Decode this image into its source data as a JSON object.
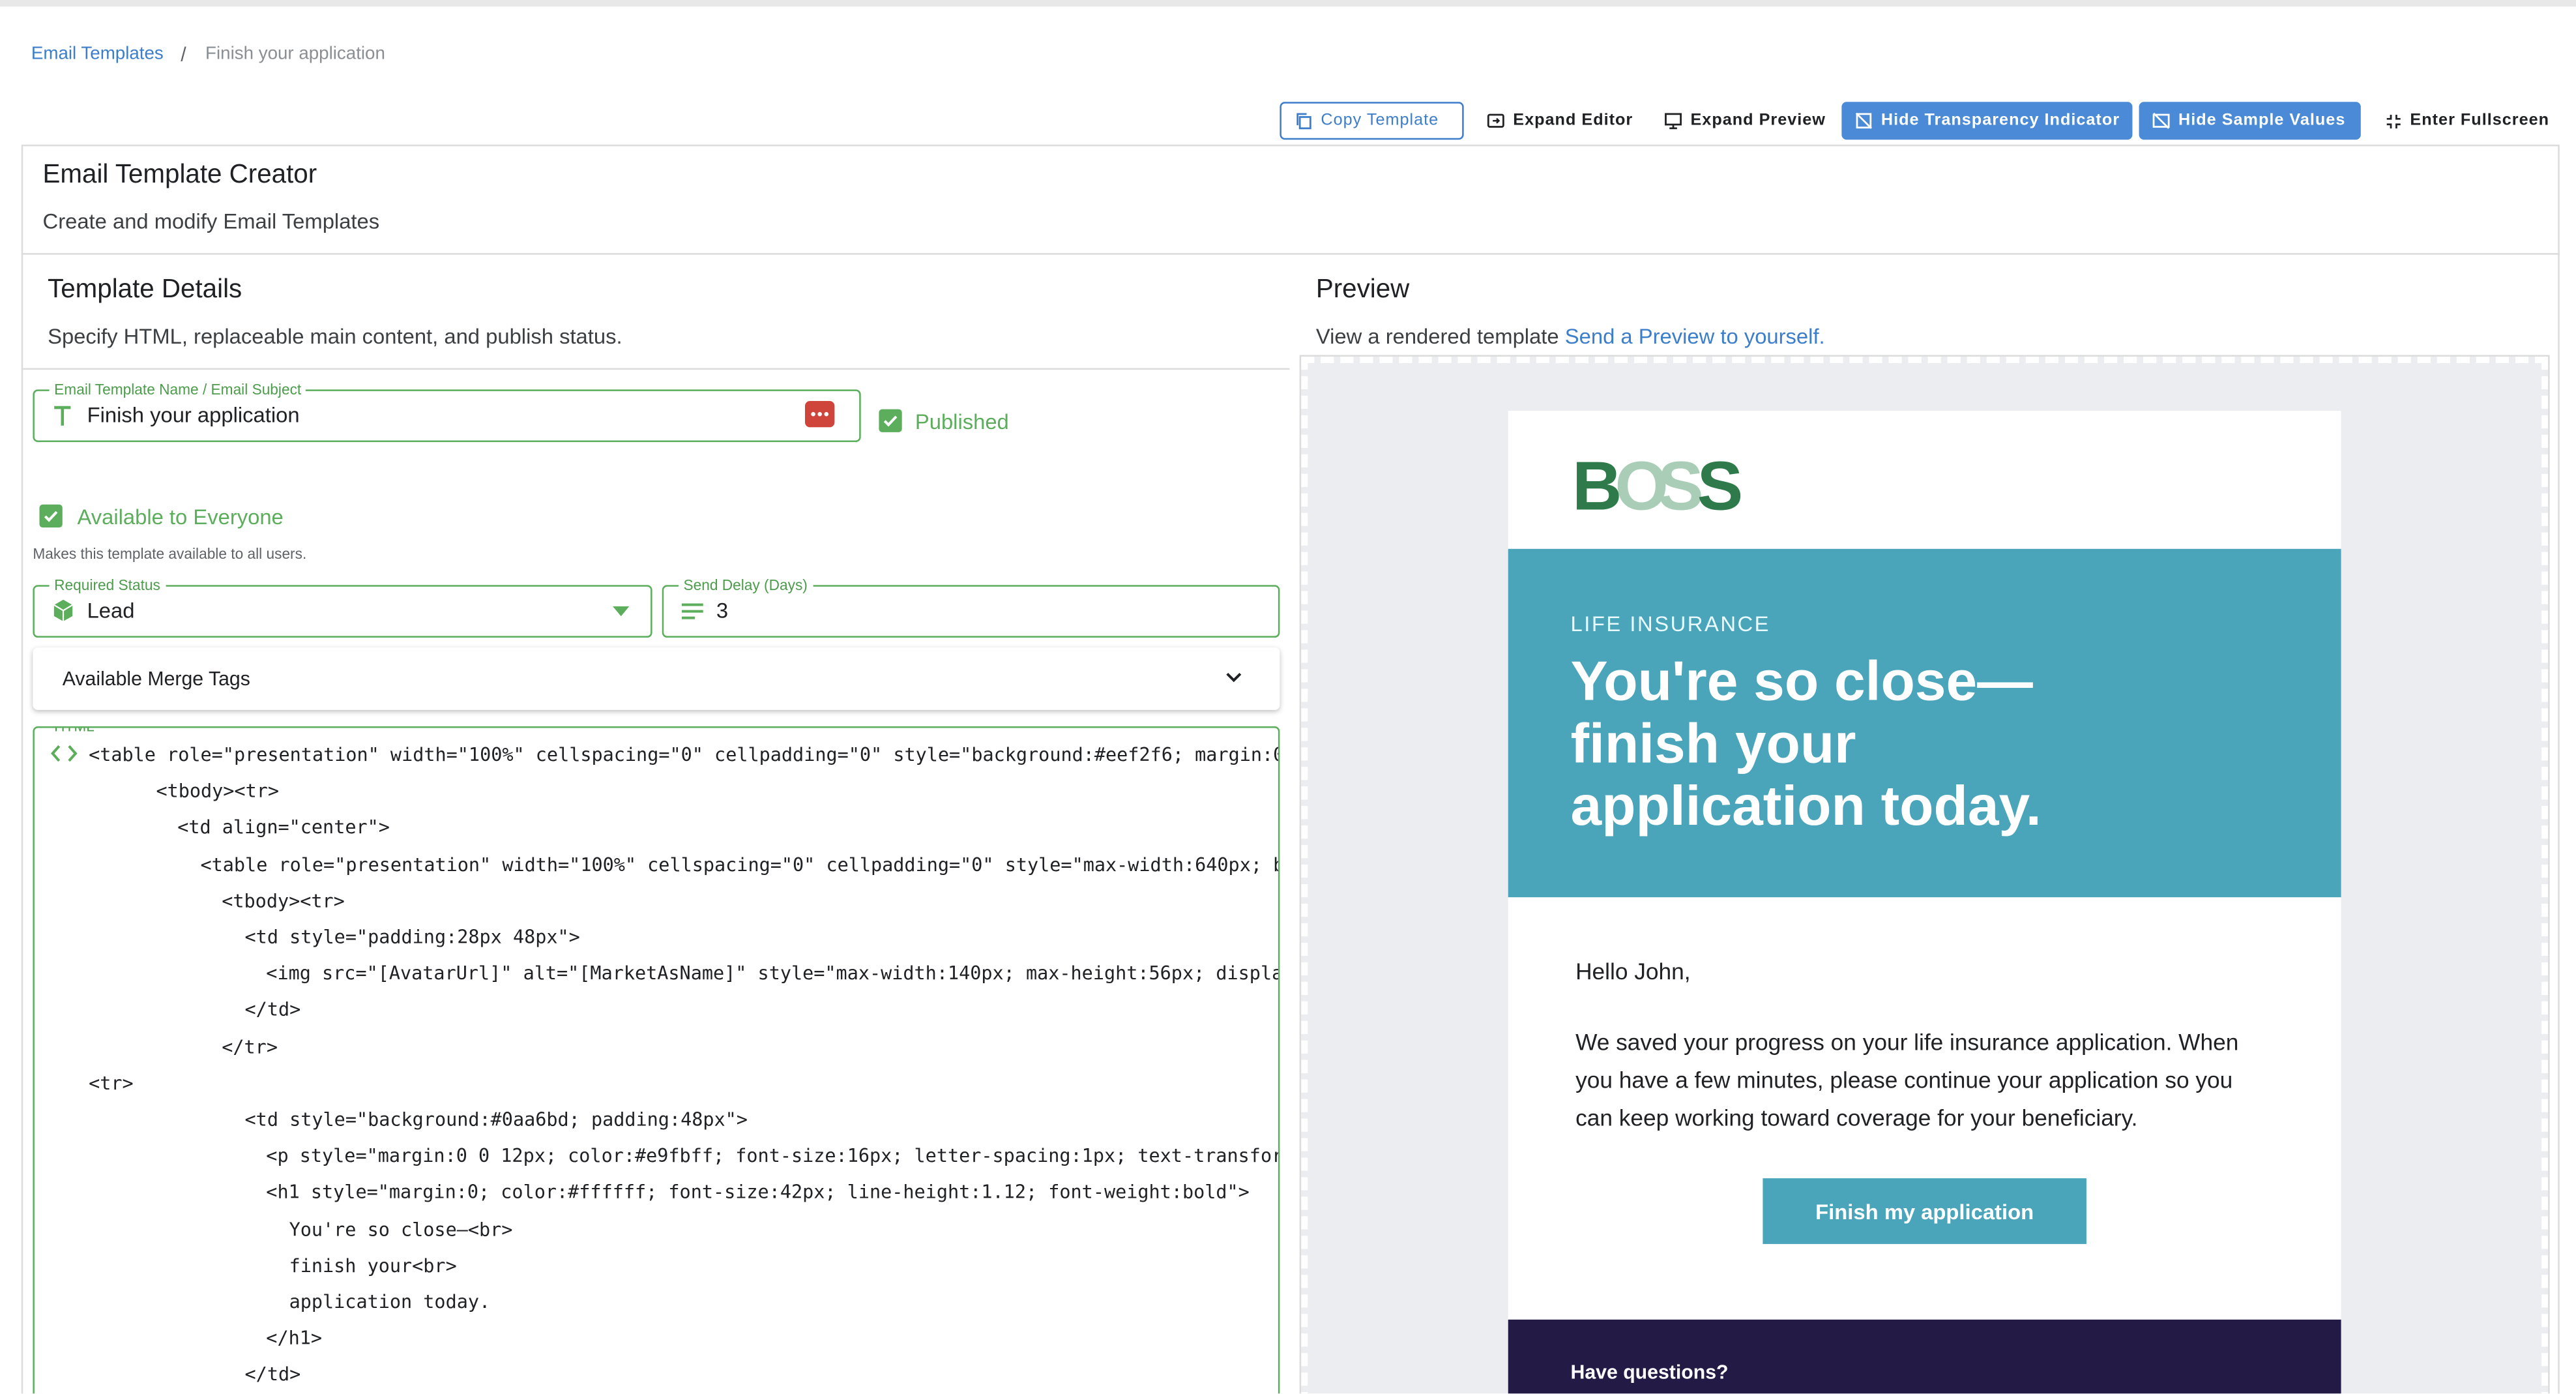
{
  "breadcrumb": {
    "link": "Email Templates",
    "separator": "/",
    "current": "Finish your application"
  },
  "toolbar": {
    "copy_template": "Copy Template",
    "expand_editor": "Expand Editor",
    "expand_preview": "Expand Preview",
    "hide_transparency": "Hide Transparency Indicator",
    "hide_sample_values": "Hide Sample Values",
    "enter_fullscreen": "Enter Fullscreen"
  },
  "header": {
    "title": "Email Template Creator",
    "subtitle": "Create and modify Email Templates"
  },
  "details": {
    "title": "Template Details",
    "subtitle": "Specify HTML, replaceable main content, and publish status.",
    "name_label": "Email Template Name / Email Subject",
    "name_value": "Finish your application",
    "published_label": "Published",
    "available_label": "Available to Everyone",
    "available_helper": "Makes this template available to all users.",
    "status_label": "Required Status",
    "status_value": "Lead",
    "delay_label": "Send Delay (Days)",
    "delay_value": "3",
    "merge_tags_label": "Available Merge Tags",
    "html_label": "HTML"
  },
  "code_lines": [
    "<table role=\"presentation\" width=\"100%\" cellspacing=\"0\" cellpadding=\"0\" style=\"background:#eef2f6; margin:0",
    "<tbody><tr>",
    "<td align=\"center\">",
    "<table role=\"presentation\" width=\"100%\" cellspacing=\"0\" cellpadding=\"0\" style=\"max-width:640px; b",
    "<tbody><tr>",
    "<td style=\"padding:28px 48px\">",
    "<img src=\"[AvatarUrl]\" alt=\"[MarketAsName]\" style=\"max-width:140px; max-height:56px; displa",
    "</td>",
    "</tr>",
    "<tr>",
    "<td style=\"background:#0aa6bd; padding:48px\">",
    "<p style=\"margin:0 0 12px; color:#e9fbff; font-size:16px; letter-spacing:1px; text-transfor",
    "<h1 style=\"margin:0; color:#ffffff; font-size:42px; line-height:1.12; font-weight:bold\">",
    "You're so close—<br>",
    "finish your<br>",
    "application today.",
    "</h1>",
    "</td>"
  ],
  "preview": {
    "title": "Preview",
    "subtitle": "View a rendered template",
    "link": "Send a Preview to yourself.",
    "logo_text": "BOSS",
    "eyebrow": "LIFE INSURANCE",
    "headline_1": "You're so close—",
    "headline_2": "finish your",
    "headline_3": "application today.",
    "greeting": "Hello John,",
    "body_1": "We saved your progress on your life insurance application. When",
    "body_2": "you have a few minutes, please continue your application so you",
    "body_3": "can keep working toward coverage for your beneficiary.",
    "cta": "Finish my application",
    "footer_title": "Have questions?"
  },
  "colors": {
    "accent": "#3d7ecb",
    "green": "#5cae5c",
    "hero": "#4aa5bb",
    "footer": "#231b45",
    "logo_dark": "#2f7a4a",
    "logo_light": "#a9cdb6"
  }
}
